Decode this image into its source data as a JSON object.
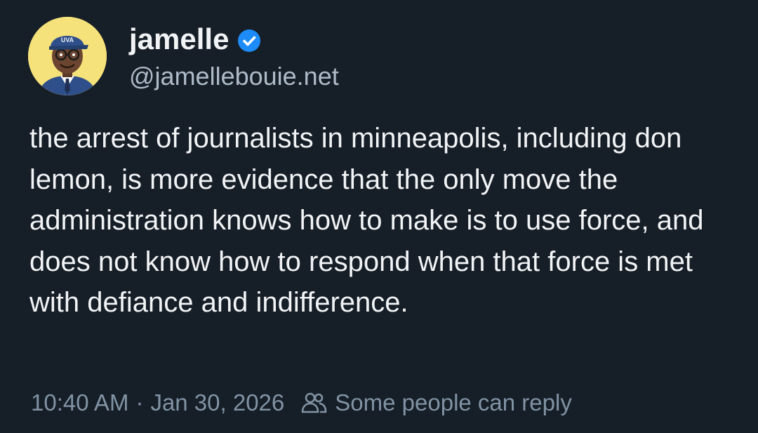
{
  "post": {
    "display_name": "jamelle",
    "handle": "@jamellebouie.net",
    "verified_icon": "verified-check-icon",
    "avatar_icon": "avatar-illustration",
    "text": "the arrest of journalists in minneapolis, including don lemon, is more evidence that the only move the administration knows how to make is to use force, and does not know how to respond when that force is met with defiance and indifference.",
    "time": "10:40 AM",
    "separator": "·",
    "date": "Jan 30, 2026",
    "reply_setting_icon": "people-icon",
    "reply_setting": "Some people can reply"
  },
  "colors": {
    "background": "#161e27",
    "text_primary": "#f1f3f5",
    "text_secondary": "#aebbc9",
    "text_muted": "#8193a5",
    "verified_blue": "#1d8cf8",
    "avatar_bg": "#f6e27a"
  }
}
